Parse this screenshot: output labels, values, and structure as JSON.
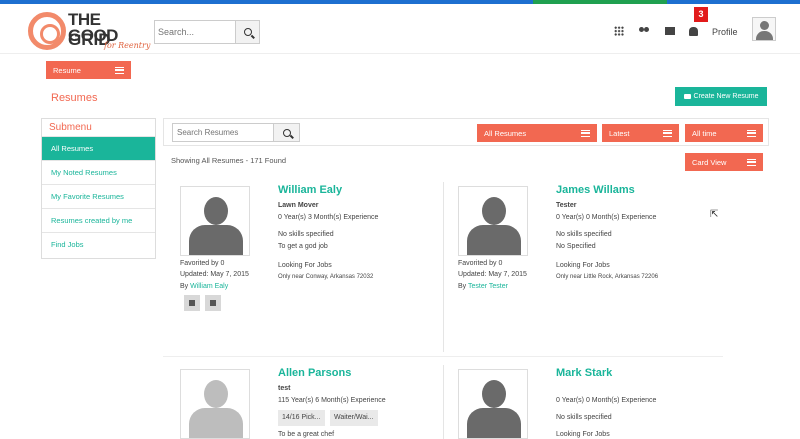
{
  "brand": {
    "line1": "THE GOOD",
    "line2": "GRID",
    "tagline": "for Reentry",
    "stripe_colors": [
      "#1d6fd0",
      "#1d6fd0",
      "#1d6fd0",
      "#1d6fd0",
      "#20a050",
      "#1d6fd0"
    ]
  },
  "header": {
    "search_placeholder": "Search...",
    "notification_count": "3",
    "profile_label": "Profile"
  },
  "resume_button": "Resume",
  "page_title": "Resumes",
  "create_button": "Create New Resume",
  "sidebar": {
    "title": "Submenu",
    "items": [
      {
        "label": "All Resumes",
        "active": true
      },
      {
        "label": "My Noted Resumes"
      },
      {
        "label": "My Favorite Resumes"
      },
      {
        "label": "Resumes created by me"
      },
      {
        "label": "Find Jobs"
      }
    ]
  },
  "toolbar": {
    "search_placeholder": "Search Resumes",
    "filters": [
      "All Resumes",
      "Latest",
      "All time"
    ]
  },
  "showing": "Showing All Resumes - 171 Found",
  "card_view": "Card View",
  "cards": [
    {
      "name": "William Ealy",
      "title": "Lawn Mover",
      "experience": "0 Year(s) 3 Month(s) Experience",
      "skills": "No skills specified",
      "goal": "To get a god job",
      "favorited": "Favorited by 0",
      "updated": "Updated: May 7, 2015",
      "by_prefix": "By",
      "by": "William Ealy",
      "looking_label": "Looking For Jobs",
      "location": "Only near Conway, Arkansas 72032"
    },
    {
      "name": "James Willams",
      "title": "Tester",
      "experience": "0 Year(s) 0 Month(s) Experience",
      "skills": "No skills specified",
      "goal": "No Specified",
      "favorited": "Favorited by 0",
      "updated": "Updated: May 7, 2015",
      "by_prefix": "By",
      "by": "Tester Tester",
      "looking_label": "Looking For Jobs",
      "location": "Only near Little Rock, Arkansas 72206"
    },
    {
      "name": "Allen Parsons",
      "title": "test",
      "experience": "115 Year(s) 6 Month(s) Experience",
      "tags": [
        "14/16 Pick...",
        "Waiter/Wai..."
      ],
      "goal": "To be a great chef"
    },
    {
      "name": "Mark Stark",
      "experience": "0 Year(s) 0 Month(s) Experience",
      "skills": "No skills specified",
      "looking_label": "Looking For Jobs"
    }
  ]
}
